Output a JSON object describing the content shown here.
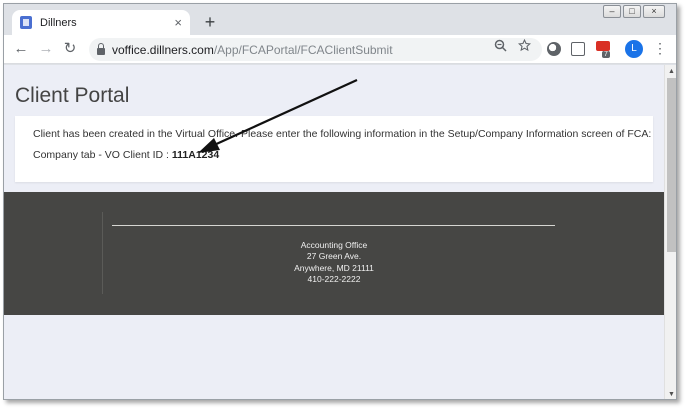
{
  "tab": {
    "title": "Dillners",
    "close": "×",
    "new_tab": "+"
  },
  "toolbar": {
    "back": "←",
    "forward": "→",
    "reload": "↻",
    "url_domain": "voffice.dillners.com",
    "url_path": "/App/FCAPortal/FCAClientSubmit",
    "extension_badge": "7",
    "avatar_initial": "L",
    "menu": "⋮"
  },
  "window_controls": {
    "minimize": "–",
    "maximize": "□",
    "close": "×"
  },
  "page": {
    "title": "Client Portal",
    "message": "Client has been created in the Virtual Office. Please enter the following information in the Setup/Company Information screen of FCA:",
    "client_id_label": "Company tab - VO Client ID : ",
    "client_id_value": "111A1234"
  },
  "footer": {
    "name": "Accounting Office",
    "street": "27 Green Ave.",
    "city": "Anywhere, MD 21111",
    "phone": "410-222-2222"
  },
  "colors": {
    "footer_bg": "#464644",
    "page_bg": "#eceef6",
    "accent": "#1a73e8"
  }
}
